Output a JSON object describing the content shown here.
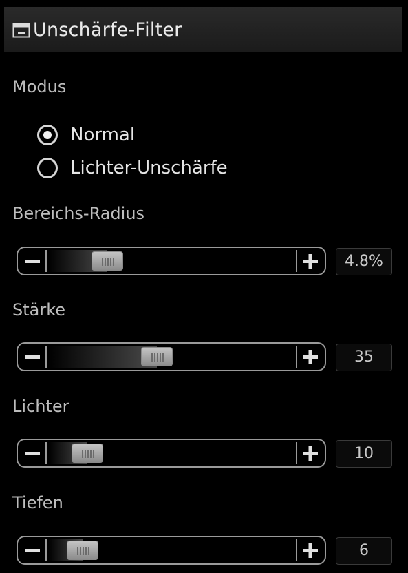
{
  "header": {
    "title": "Unschärfe-Filter",
    "icon": "panel-icon"
  },
  "modus": {
    "label": "Modus",
    "options": [
      {
        "label": "Normal",
        "selected": true
      },
      {
        "label": "Lichter-Unschärfe",
        "selected": false
      }
    ]
  },
  "sliders": [
    {
      "label": "Bereichs-Radius",
      "value_text": "4.8%",
      "position": 0.24
    },
    {
      "label": "Stärke",
      "value_text": "35",
      "position": 0.44
    },
    {
      "label": "Lichter",
      "value_text": "10",
      "position": 0.16
    },
    {
      "label": "Tiefen",
      "value_text": "6",
      "position": 0.14
    }
  ],
  "colors": {
    "background": "#000000",
    "titlebar": "#222222",
    "text": "#d9d9d9",
    "control_border": "#9a9a9a"
  }
}
